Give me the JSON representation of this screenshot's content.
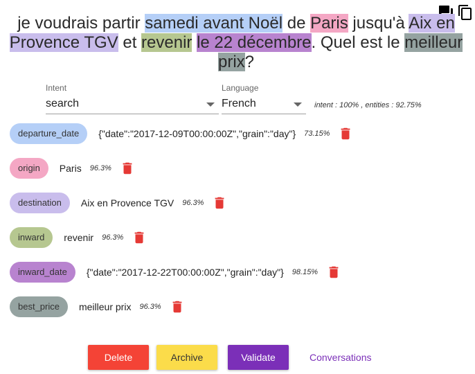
{
  "top_icons": [
    "forum-icon",
    "copy-icon"
  ],
  "sentence": [
    {
      "text": "je voudrais partir ",
      "bg": ""
    },
    {
      "text": "samedi avant Noël",
      "bg": "#b5cff7"
    },
    {
      "text": " de ",
      "bg": ""
    },
    {
      "text": "Paris",
      "bg": "#f4a7c4"
    },
    {
      "text": " jusqu'à ",
      "bg": ""
    },
    {
      "text": "Aix en Provence TGV",
      "bg": "#c9bdec"
    },
    {
      "text": " et ",
      "bg": ""
    },
    {
      "text": "revenir",
      "bg": "#b6c790"
    },
    {
      "text": " ",
      "bg": ""
    },
    {
      "text": "le 22 décembre",
      "bg": "#b883cf"
    },
    {
      "text": ". Quel est le ",
      "bg": ""
    },
    {
      "text": "meilleur prix",
      "bg": "#95a3a1"
    },
    {
      "text": "?",
      "bg": ""
    }
  ],
  "intent": {
    "label": "Intent",
    "value": "search"
  },
  "language": {
    "label": "Language",
    "value": "French"
  },
  "scores": "intent : 100% , entities : 92.75%",
  "entities": [
    {
      "role": "departure_date",
      "value": "{\"date\":\"2017-12-09T00:00:00Z\",\"grain\":\"day\"}",
      "score": "73.15%",
      "color": "#b5cff7"
    },
    {
      "role": "origin",
      "value": "Paris",
      "score": "96.3%",
      "color": "#f4a7c4"
    },
    {
      "role": "destination",
      "value": "Aix en Provence TGV",
      "score": "96.3%",
      "color": "#c9bdec"
    },
    {
      "role": "inward",
      "value": "revenir",
      "score": "96.3%",
      "color": "#b6c790"
    },
    {
      "role": "inward_date",
      "value": "{\"date\":\"2017-12-22T00:00:00Z\",\"grain\":\"day\"}",
      "score": "98.15%",
      "color": "#b883cf"
    },
    {
      "role": "best_price",
      "value": "meilleur prix",
      "score": "96.3%",
      "color": "#95a3a1"
    }
  ],
  "buttons": {
    "delete": {
      "label": "Delete",
      "bg": "#f44336",
      "fg": "#ffffff"
    },
    "archive": {
      "label": "Archive",
      "bg": "#fbdc4a",
      "fg": "#333333"
    },
    "validate": {
      "label": "Validate",
      "bg": "#7b2fb8",
      "fg": "#ffffff"
    },
    "conversations": {
      "label": "Conversations",
      "fg": "#7b2fb8"
    }
  },
  "colors": {
    "trash": "#e53935"
  }
}
